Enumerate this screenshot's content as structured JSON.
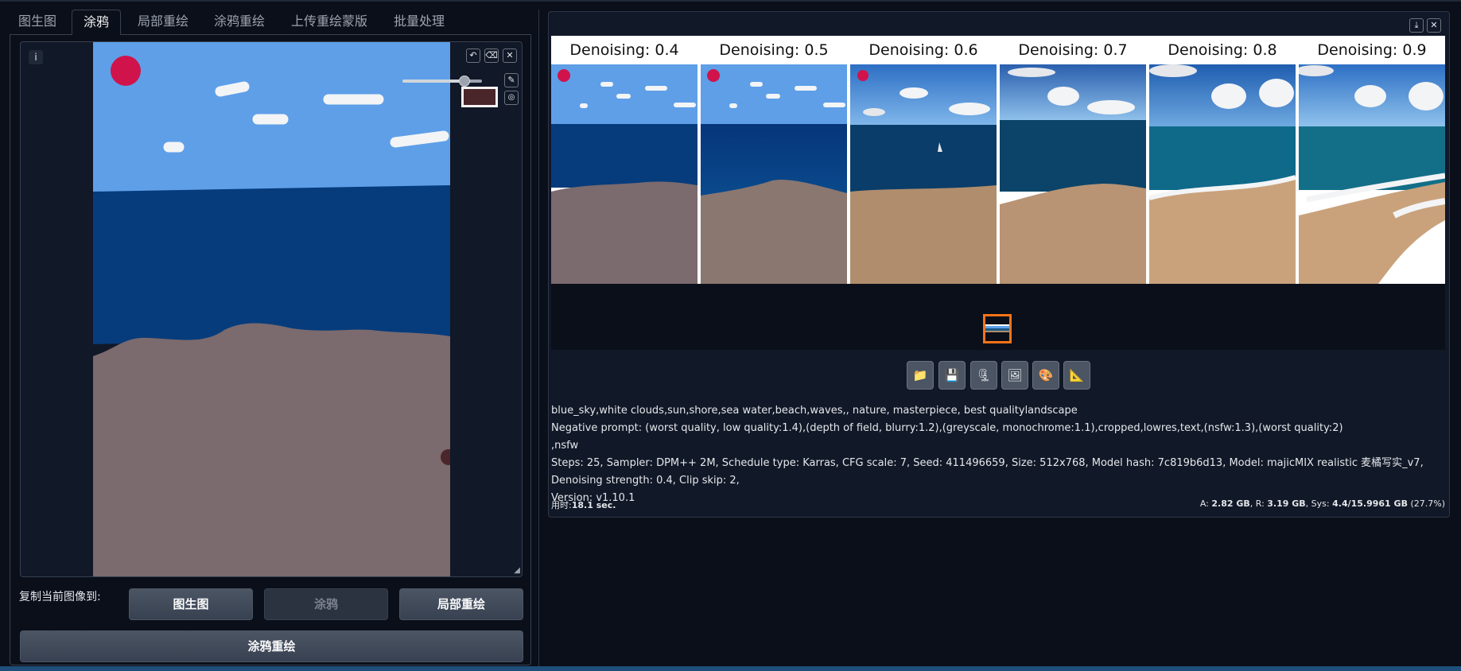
{
  "tabs": [
    "图生图",
    "涂鸦",
    "局部重绘",
    "涂鸦重绘",
    "上传重绘蒙版",
    "批量处理"
  ],
  "active_tab": "涂鸦",
  "canvas": {
    "info_label": "i",
    "brush_size_fraction": 0.78,
    "brush_color": "#4a2529",
    "icons": [
      "undo-icon",
      "clear-icon",
      "close-icon",
      "brush-icon",
      "palette-icon"
    ]
  },
  "copy_to": {
    "label": "复制当前图像到:",
    "buttons": [
      "图生图",
      "涂鸦",
      "局部重绘"
    ]
  },
  "generate_label": "涂鸦重绘",
  "results": {
    "captions": [
      "Denoising: 0.4",
      "Denoising: 0.5",
      "Denoising: 0.6",
      "Denoising: 0.7",
      "Denoising: 0.8",
      "Denoising: 0.9"
    ],
    "selected_thumbnail": 1
  },
  "toolbar_icons": [
    "folder-icon",
    "save-icon",
    "zip-icon",
    "image-icon",
    "palette-icon",
    "ruler-icon"
  ],
  "params": {
    "prompt": "blue_sky,white clouds,sun,shore,sea water,beach,waves,, nature, masterpiece, best qualitylandscape",
    "negative": "Negative prompt: (worst quality, low quality:1.4),(depth of field, blurry:1.2),(greyscale, monochrome:1.1),cropped,lowres,text,(nsfw:1.3),(worst quality:2)",
    "negative_cont": ",nsfw",
    "settings": "Steps: 25, Sampler: DPM++ 2M, Schedule type: Karras, CFG scale: 7, Seed: 411496659, Size: 512x768, Model hash: 7c819b6d13, Model: majicMIX realistic 麦橘写实_v7, Denoising strength: 0.4, Clip skip: 2,",
    "version": "Version: v1.10.1"
  },
  "timing": {
    "label": "用时:",
    "value": "18.1 sec."
  },
  "memory": {
    "a_label": "A:",
    "a_value": "2.82 GB",
    "r_label": "R:",
    "r_value": "3.19 GB",
    "sys_label": "Sys:",
    "sys_value": "4.4/15.9961 GB",
    "percent": "(27.7%)"
  },
  "colors": {
    "sky": "#5e9fe8",
    "sea": "#063c7c",
    "sand": "#7b6a6e",
    "sun": "#d0134b",
    "accent": "#f97316"
  }
}
